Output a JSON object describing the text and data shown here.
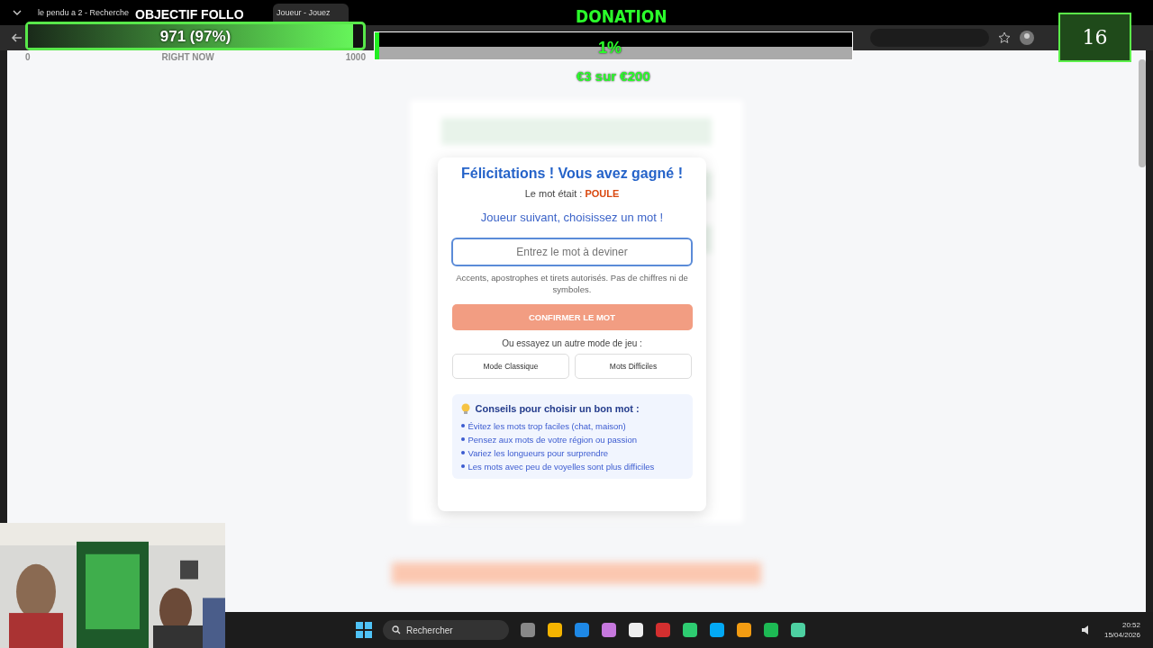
{
  "browser": {
    "tabs": [
      {
        "label": "le pendu a 2 - Recherche",
        "selected": false
      },
      {
        "label": "Joueur - Jouez",
        "selected": true
      }
    ]
  },
  "follower_goal": {
    "title": "OBJECTIF FOLLO",
    "reading": "971 (97%)",
    "level": 0.97,
    "min": "0",
    "mid": "RIGHT NOW",
    "max": "1000"
  },
  "donation_goal": {
    "title": "DONATION",
    "reading": "1%",
    "level": 0.01,
    "amount": "€3 sur €200"
  },
  "counter": "16",
  "modal": {
    "title": "Félicitations ! Vous avez gagné !",
    "result_label": "Le mot était :",
    "word": "POULE",
    "prompt": "Joueur suivant, choisissez un mot !",
    "input": {
      "placeholder": "Entrez le mot à deviner"
    },
    "hint": "Accents, apostrophes et tirets autorisés. Pas de chiffres ni de symboles.",
    "confirm": "CONFIRMER LE MOT",
    "alt_label": "Ou essayez un autre mode de jeu :",
    "modes": [
      "Mode Classique",
      "Mots Difficiles"
    ],
    "tips_title": "Conseils pour choisir un bon mot :",
    "tips": [
      "Évitez les mots trop faciles (chat, maison)",
      "Pensez aux mots de votre région ou passion",
      "Variez les longueurs pour surprendre",
      "Les mots avec peu de voyelles sont plus difficiles"
    ]
  },
  "taskbar": {
    "search": "Rechercher",
    "time": "20:52",
    "date": "15/04/2026"
  }
}
